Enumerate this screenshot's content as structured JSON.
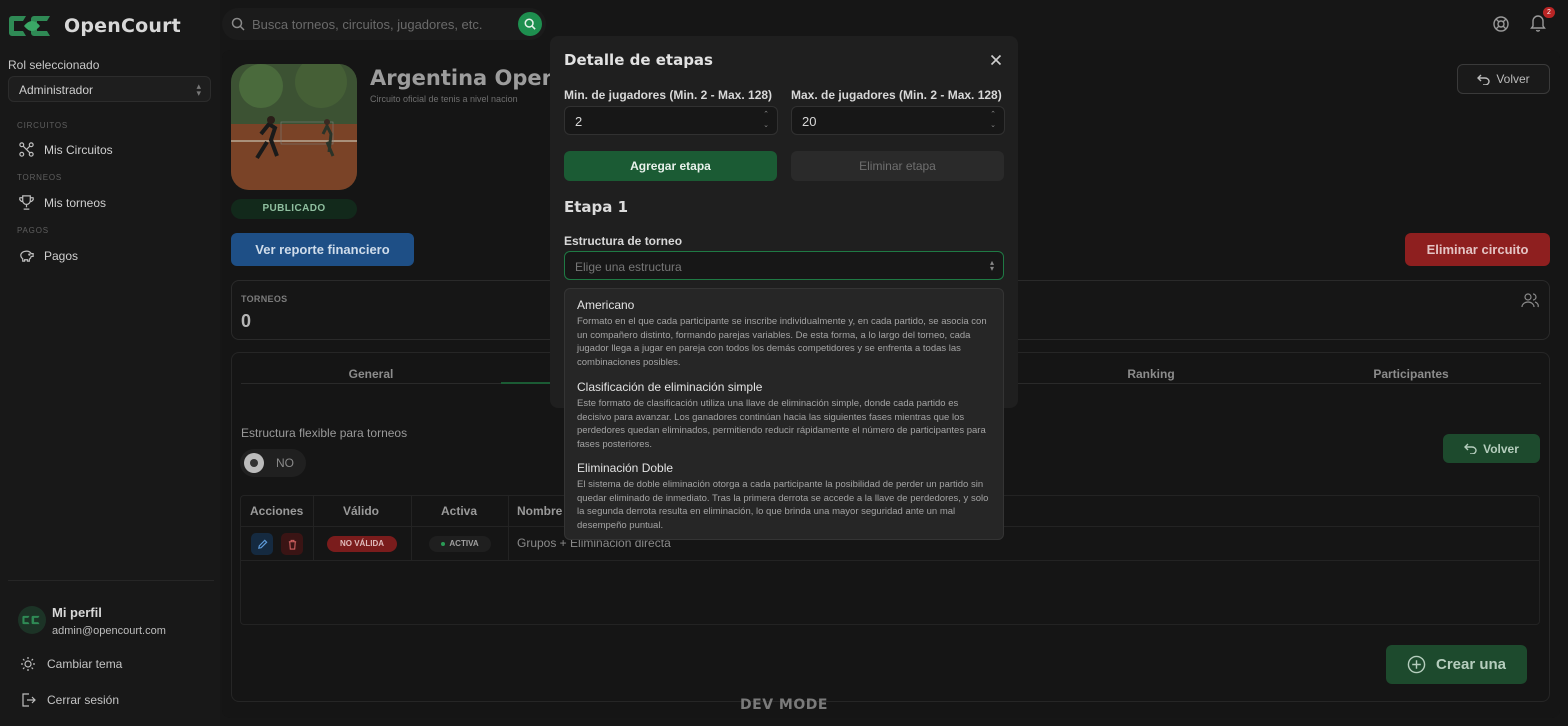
{
  "app": {
    "name": "OpenCourt"
  },
  "sidebar": {
    "role_label": "Rol seleccionado",
    "role_value": "Administrador",
    "sections": [
      {
        "label": "CIRCUITOS",
        "item": "Mis Circuitos",
        "icon": "circuit-icon"
      },
      {
        "label": "TORNEOS",
        "item": "Mis torneos",
        "icon": "trophy-icon"
      },
      {
        "label": "PAGOS",
        "item": "Pagos",
        "icon": "piggy-bank-icon"
      }
    ],
    "profile": {
      "name": "Mi perfil",
      "email": "admin@opencourt.com"
    },
    "theme_label": "Cambiar tema",
    "logout_label": "Cerrar sesión"
  },
  "topbar": {
    "search_placeholder": "Busca torneos, circuitos, jugadores, etc.",
    "notification_count": "2"
  },
  "circuit": {
    "title": "Argentina Open",
    "subtitle": "Circuito oficial de tenis a nivel nacion",
    "status": "PUBLICADO",
    "back_label": "Volver",
    "report_label": "Ver reporte financiero",
    "delete_label": "Eliminar circuito",
    "stats": {
      "label": "TORNEOS",
      "value": "0"
    }
  },
  "tabs": [
    "General",
    "",
    "",
    "",
    "Ranking",
    "Participantes"
  ],
  "structures": {
    "flex_label": "Estructura flexible para torneos",
    "toggle_label": "NO",
    "back_label": "Volver",
    "columns": [
      "Acciones",
      "Válido",
      "Activa",
      "Nombre"
    ],
    "rows": [
      {
        "valid": "NO VÁLIDA",
        "active": "ACTIVA",
        "name": "Grupos + Eliminación directa"
      }
    ],
    "create_label": "Crear una"
  },
  "dev_mode": "DEV MODE",
  "modal": {
    "title": "Detalle de etapas",
    "min_label": "Min. de jugadores (Min. 2 - Max. 128)",
    "min_value": "2",
    "max_label": "Max. de jugadores (Min. 2 - Max. 128)",
    "max_value": "20",
    "add_label": "Agregar etapa",
    "remove_label": "Eliminar etapa",
    "stage_title": "Etapa 1",
    "structure_label": "Estructura de torneo",
    "structure_placeholder": "Elige una estructura"
  },
  "dropdown": {
    "options": [
      {
        "title": "Americano",
        "description": "Formato en el que cada participante se inscribe individualmente y, en cada partido, se asocia con un compañero distinto, formando parejas variables. De esta forma, a lo largo del torneo, cada jugador llega a jugar en pareja con todos los demás competidores y se enfrenta a todas las combinaciones posibles."
      },
      {
        "title": "Clasificación de eliminación simple",
        "description": "Este formato de clasificación utiliza una llave de eliminación simple, donde cada partido es decisivo para avanzar. Los ganadores continúan hacia las siguientes fases mientras que los perdedores quedan eliminados, permitiendo reducir rápidamente el número de participantes para fases posteriores."
      },
      {
        "title": "Eliminación Doble",
        "description": "El sistema de doble eliminación otorga a cada participante la posibilidad de perder un partido sin quedar eliminado de inmediato. Tras la primera derrota se accede a la llave de perdedores, y solo la segunda derrota resulta en eliminación, lo que brinda una mayor seguridad ante un mal desempeño puntual."
      }
    ]
  },
  "colors": {
    "brand_green": "#1b5b34",
    "accent_green": "#1e8f4f",
    "danger": "#8e1f1f",
    "info": "#1e4f86"
  }
}
